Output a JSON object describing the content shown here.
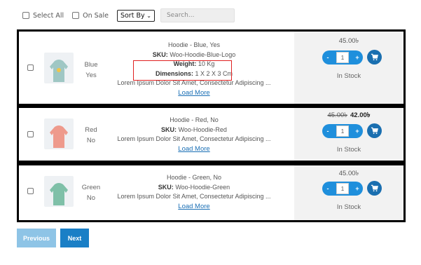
{
  "toolbar": {
    "select_all": "Select All",
    "on_sale": "On Sale",
    "sort": "Sort By",
    "search_placeholder": "Search..."
  },
  "products": [
    {
      "color": "Blue",
      "logo": "Yes",
      "title": "Hoodie - Blue, Yes",
      "sku_label": "SKU:",
      "sku": "Woo-Hoodie-Blue-Logo",
      "weight_label": "Weight:",
      "weight": "10 Kg",
      "dimensions_label": "Dimensions:",
      "dimensions": "1 X 2 X 3 Cm",
      "description": "Lorem Ipsum Dolor Sit Amet, Consectetur Adipiscing ...",
      "load_more": "Load More",
      "price": "45.00৳",
      "qty_minus": "-",
      "qty": "1",
      "qty_plus": "+",
      "stock": "In Stock",
      "hoodie_color": "#9fc7c4"
    },
    {
      "color": "Red",
      "logo": "No",
      "title": "Hoodie - Red, No",
      "sku_label": "SKU:",
      "sku": "Woo-Hoodie-Red",
      "description": "Lorem Ipsum Dolor Sit Amet, Consectetur Adipiscing ...",
      "load_more": "Load More",
      "regular_price": "45.00৳",
      "sale_price": "42.00৳",
      "qty_minus": "-",
      "qty": "1",
      "qty_plus": "+",
      "stock": "In Stock",
      "hoodie_color": "#ee9a8c"
    },
    {
      "color": "Green",
      "logo": "No",
      "title": "Hoodie - Green, No",
      "sku_label": "SKU:",
      "sku": "Woo-Hoodie-Green",
      "description": "Lorem Ipsum Dolor Sit Amet, Consectetur Adipiscing ...",
      "load_more": "Load More",
      "price": "45.00৳",
      "qty_minus": "-",
      "qty": "1",
      "qty_plus": "+",
      "stock": "In Stock",
      "hoodie_color": "#7fc0a8"
    }
  ],
  "pagination": {
    "previous": "Previous",
    "next": "Next"
  },
  "colors": {
    "accent": "#1f8fdc",
    "cart": "#1a6fb0",
    "highlight": "#e02020"
  }
}
